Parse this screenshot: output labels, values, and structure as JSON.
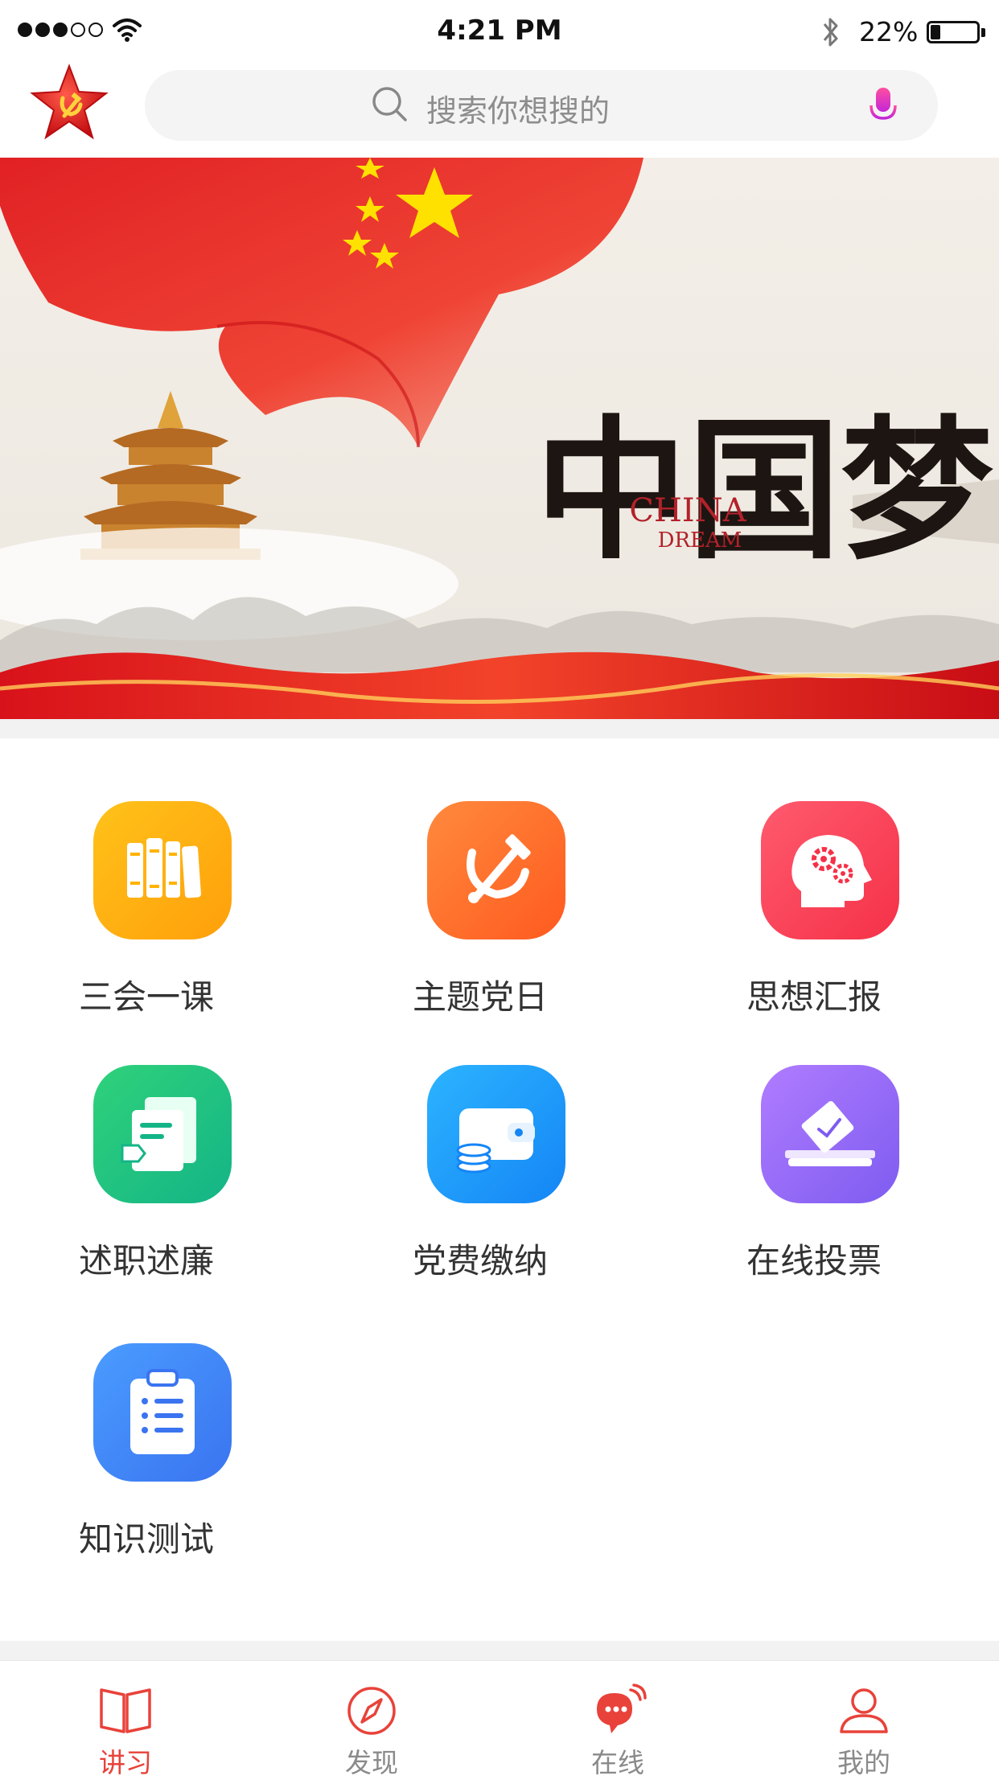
{
  "status_bar": {
    "time": "4:21 PM",
    "battery_percent": "22%",
    "battery_level": 0.22
  },
  "header": {
    "search_placeholder": "搜索你想搜的",
    "logo_icon": "party-star-logo-icon"
  },
  "banner": {
    "title_cn": "中国梦",
    "title_en_1": "CHINA",
    "title_en_2": "DREAM"
  },
  "grid": {
    "items": [
      {
        "label": "三会一课",
        "icon": "books-icon",
        "color_start": "#ffc21a",
        "color_end": "#ff9f0a"
      },
      {
        "label": "主题党日",
        "icon": "hammer-sickle-icon",
        "color_start": "#ff8a3d",
        "color_end": "#ff5a1f"
      },
      {
        "label": "思想汇报",
        "icon": "brain-gears-icon",
        "color_start": "#ff5a6e",
        "color_end": "#f53148"
      },
      {
        "label": "述职述廉",
        "icon": "report-document-icon",
        "color_start": "#2fd27a",
        "color_end": "#14b487"
      },
      {
        "label": "党费缴纳",
        "icon": "wallet-coins-icon",
        "color_start": "#2cb4ff",
        "color_end": "#1485f5"
      },
      {
        "label": "在线投票",
        "icon": "ballot-box-icon",
        "color_start": "#b07cff",
        "color_end": "#7e5cf0"
      },
      {
        "label": "知识测试",
        "icon": "clipboard-list-icon",
        "color_start": "#4a9cff",
        "color_end": "#3a74f0"
      }
    ]
  },
  "tabbar": {
    "tabs": [
      {
        "label": "讲习",
        "icon": "book-icon",
        "active": true
      },
      {
        "label": "发现",
        "icon": "compass-icon",
        "active": false
      },
      {
        "label": "在线",
        "icon": "chat-bubble-icon",
        "active": false
      },
      {
        "label": "我的",
        "icon": "user-icon",
        "active": false
      }
    ],
    "active_color": "#e8423a",
    "inactive_color": "#8a8a8a"
  }
}
